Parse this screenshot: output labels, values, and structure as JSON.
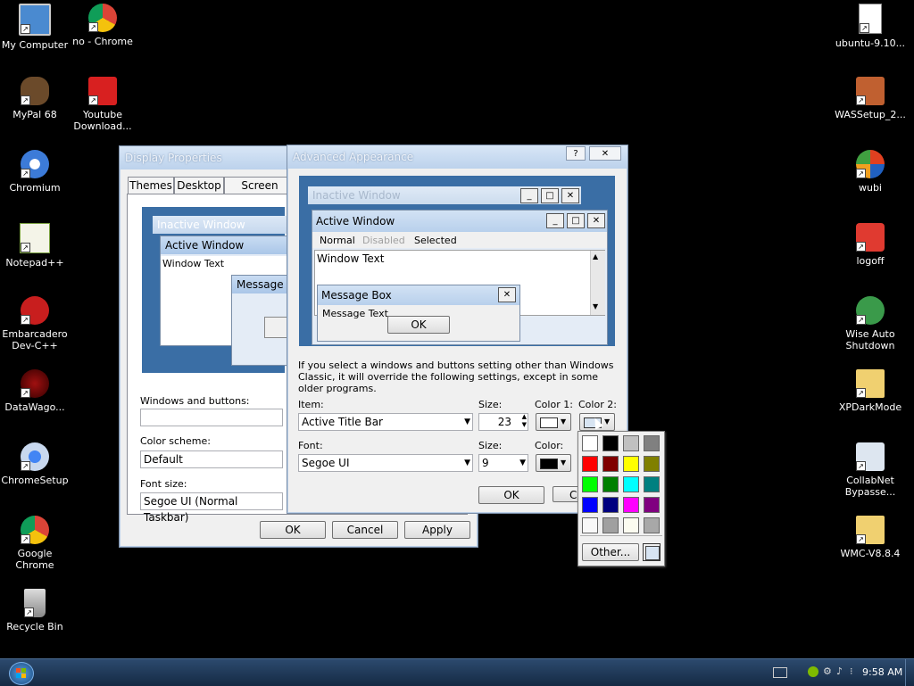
{
  "desktop": {
    "left_icons": [
      {
        "label": "My Computer",
        "icon": "computer-icon"
      },
      {
        "label": "no - Chrome",
        "icon": "chrome-icon"
      },
      {
        "label": "MyPal 68",
        "icon": "mypal-icon"
      },
      {
        "label": "Youtube Download...",
        "icon": "youtube-downloader-icon"
      },
      {
        "label": "Chromium",
        "icon": "chromium-icon"
      },
      {
        "label": "Notepad++",
        "icon": "notepadpp-icon"
      },
      {
        "label": "Embarcadero Dev-C++",
        "icon": "devcpp-icon"
      },
      {
        "label": "DataWago...",
        "icon": "datawago-icon"
      },
      {
        "label": "ChromeSetup",
        "icon": "chromesetup-icon"
      },
      {
        "label": "Google Chrome",
        "icon": "google-chrome-icon"
      },
      {
        "label": "Recycle Bin",
        "icon": "recycle-bin-icon"
      }
    ],
    "right_icons": [
      {
        "label": "ubuntu-9.10...",
        "icon": "iso-file-icon"
      },
      {
        "label": "WASSetup_2...",
        "icon": "package-icon"
      },
      {
        "label": "wubi",
        "icon": "wubi-icon"
      },
      {
        "label": "logoff",
        "icon": "power-icon"
      },
      {
        "label": "Wise Auto Shutdown",
        "icon": "wise-shutdown-icon"
      },
      {
        "label": "XPDarkMode",
        "icon": "zip-folder-icon"
      },
      {
        "label": "CollabNet Bypasse...",
        "icon": "collabnet-icon"
      },
      {
        "label": "WMC-V8.8.4",
        "icon": "zip-folder-icon"
      }
    ]
  },
  "display_properties": {
    "title": "Display Properties",
    "tabs": [
      "Themes",
      "Desktop",
      "Screen Saver"
    ],
    "preview": {
      "inactive_title": "Inactive Window",
      "active_title": "Active Window",
      "window_text": "Window Text",
      "message_box_title": "Message Box"
    },
    "windows_and_buttons_label": "Windows and buttons:",
    "windows_and_buttons_value": "",
    "color_scheme_label": "Color scheme:",
    "color_scheme_value": "Default",
    "font_size_label": "Font size:",
    "font_size_value": "Segoe UI (Normal Taskbar)",
    "ok": "OK",
    "cancel": "Cancel",
    "apply": "Apply"
  },
  "advanced_appearance": {
    "title": "Advanced Appearance",
    "help_glyph": "?",
    "close_glyph": "✕",
    "preview": {
      "inactive_title": "Inactive Window",
      "active_title": "Active Window",
      "menu_normal": "Normal",
      "menu_disabled": "Disabled",
      "menu_selected": "Selected",
      "window_text": "Window Text",
      "message_box_title": "Message Box",
      "message_text": "Message Text",
      "ok": "OK"
    },
    "info_text": "If you select a windows and buttons setting other than Windows Classic, it will override the following settings, except in some older programs.",
    "item_label": "Item:",
    "item_value": "Active Title Bar",
    "size_label": "Size:",
    "size_value": "23",
    "color1_label": "Color 1:",
    "color2_label": "Color 2:",
    "font_label": "Font:",
    "font_value": "Segoe UI",
    "font_size_label": "Size:",
    "font_size_value": "9",
    "font_color_label": "Color:",
    "ok": "OK",
    "cancel": "Ca"
  },
  "color_picker": {
    "swatches": [
      "#ffffff",
      "#000000",
      "#c0c0c0",
      "#808080",
      "#ff0000",
      "#800000",
      "#ffff00",
      "#808000",
      "#00ff00",
      "#008000",
      "#00ffff",
      "#008080",
      "#0000ff",
      "#000080",
      "#ff00ff",
      "#800080",
      "#f8f8f8",
      "#a0a0a0",
      "#fbfbf0",
      "#a8a8a8"
    ],
    "other_label": "Other...",
    "selected_color": "#d7e4f2"
  },
  "taskbar": {
    "start_icon": "windows-logo-icon",
    "clock": "9:58 AM"
  }
}
